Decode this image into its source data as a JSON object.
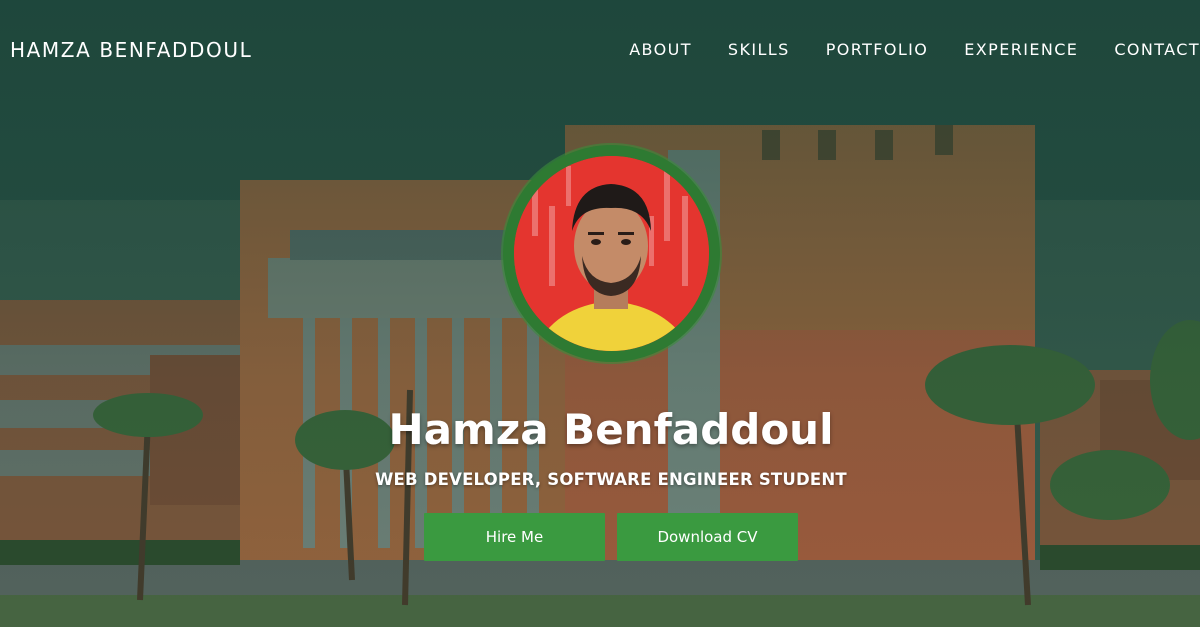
{
  "navbar": {
    "brand": "HAMZA BENFADDOUL",
    "links": [
      "ABOUT",
      "SKILLS",
      "PORTFOLIO",
      "EXPERIENCE",
      "CONTACT"
    ]
  },
  "hero": {
    "name": "Hamza Benfaddoul",
    "subtitle": "WEB DEVELOPER, SOFTWARE ENGINEER STUDENT",
    "buttons": {
      "hire": "Hire Me",
      "download": "Download CV"
    },
    "background": "school-building-photo",
    "avatar": "profile-photo"
  },
  "colors": {
    "overlay": "#2a4f44",
    "button": "#3a9a40",
    "avatar_ring": "#2e7a32"
  }
}
